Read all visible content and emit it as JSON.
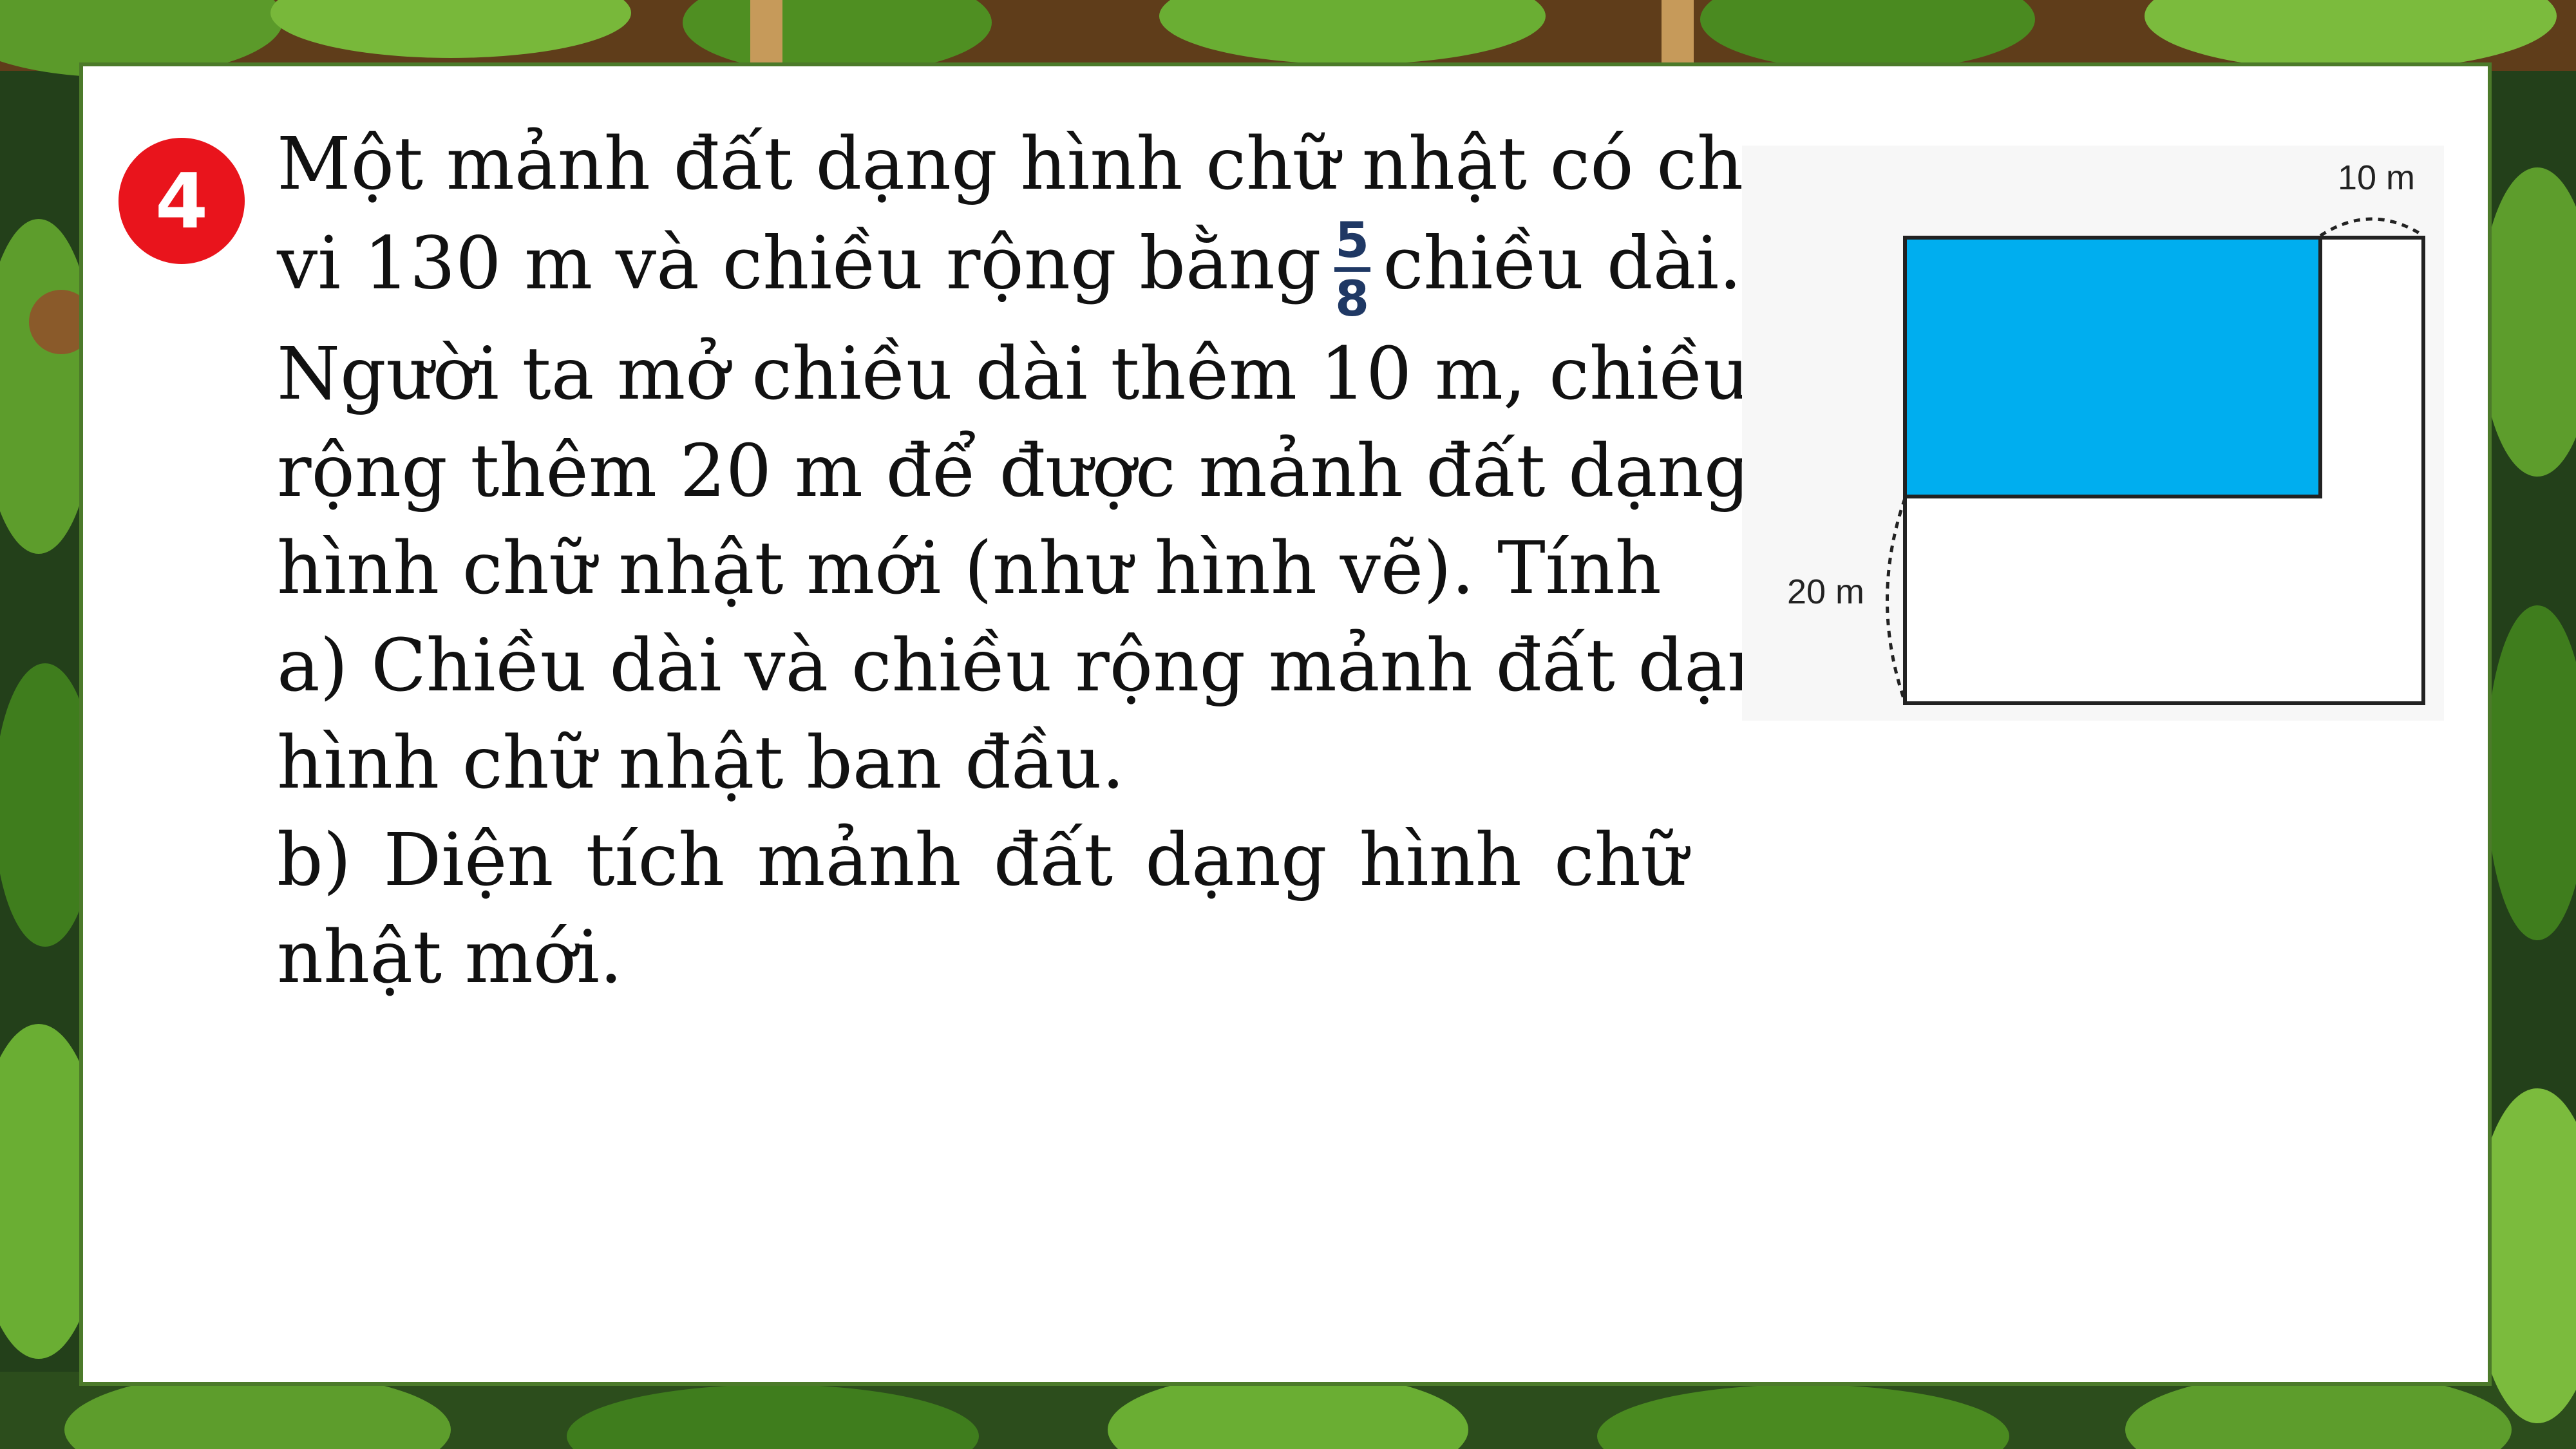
{
  "problem": {
    "number": "4",
    "line1": "Một mảnh đất dạng hình chữ nhật có chu",
    "line2_before": "vi 130 m và chiều rộng bằng",
    "fraction_numerator": "5",
    "fraction_denominator": "8",
    "line2_after": "chiều dài.",
    "line3": "Người ta mở chiều dài thêm 10 m, chiều",
    "line4": "rộng thêm 20 m để được mảnh đất dạng",
    "line5": "hình chữ nhật mới (như hình vẽ). Tính",
    "line6": "a) Chiều dài và chiều rộng mảnh đất dạng",
    "line7": "hình chữ nhật ban đầu.",
    "line8_words": [
      "b)",
      "Diện",
      "tích",
      "mảnh",
      "đất",
      "dạng",
      "hình",
      "chữ"
    ],
    "line9": "nhật mới."
  },
  "figure": {
    "top_label": "10 m",
    "left_label": "20 m",
    "original_fill": "#00aeef"
  },
  "colors": {
    "badge": "#e9141c",
    "fraction": "#1f3864",
    "frame": "#4c7a2a"
  }
}
